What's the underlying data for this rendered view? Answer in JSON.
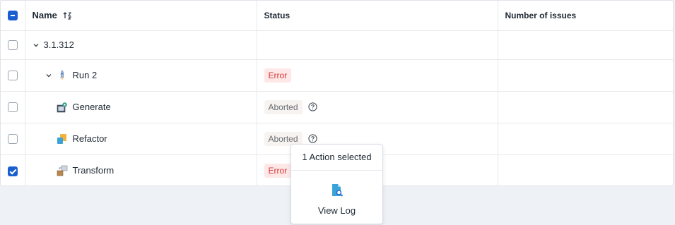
{
  "columns": {
    "name": "Name",
    "status": "Status",
    "issues": "Number of issues"
  },
  "rows": [
    {
      "name": "3.1.312",
      "level": 0,
      "status": "",
      "issues": ""
    },
    {
      "name": "Run 2",
      "level": 1,
      "status": "Error",
      "issues": ""
    },
    {
      "name": "Generate",
      "level": 2,
      "status": "Aborted",
      "issues": ""
    },
    {
      "name": "Refactor",
      "level": 2,
      "status": "Aborted",
      "issues": ""
    },
    {
      "name": "Transform",
      "level": 2,
      "status": "Error",
      "issues": ""
    }
  ],
  "popup": {
    "header": "1 Action selected",
    "action_label": "View Log"
  },
  "colors": {
    "accent": "#1a5fd0",
    "error_bg": "#fde7e7",
    "error_text": "#d93737",
    "aborted_bg": "#f6f3f1"
  },
  "icons": [
    "sort-ascending-icon",
    "chevron-down-icon",
    "rocket-icon",
    "generate-icon",
    "refactor-icon",
    "transform-icon",
    "help-circle-icon",
    "view-log-icon"
  ]
}
